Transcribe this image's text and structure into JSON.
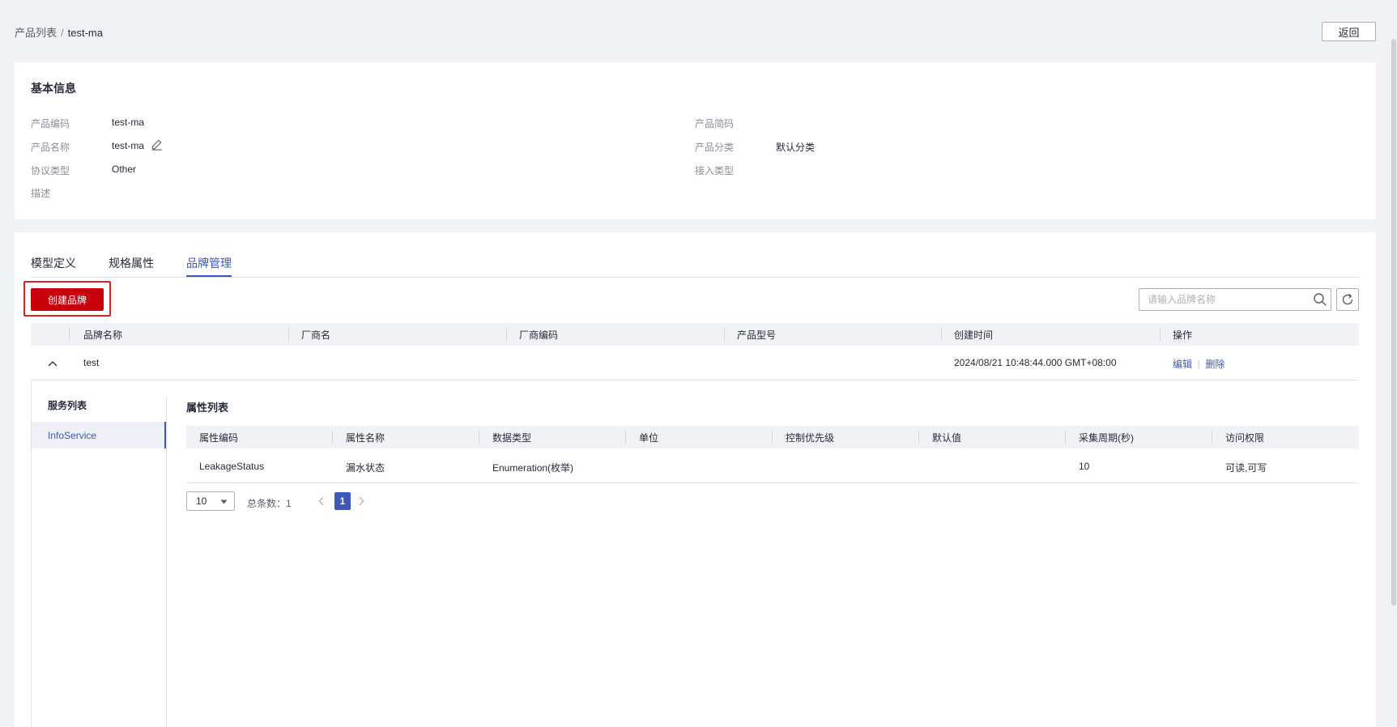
{
  "breadcrumb": {
    "parent": "产品列表",
    "separator": "/",
    "current": "test-ma"
  },
  "header": {
    "back_label": "返回"
  },
  "basic_info": {
    "title": "基本信息",
    "fields": {
      "product_code_label": "产品编码",
      "product_code_value": "test-ma",
      "product_name_label": "产品名称",
      "product_name_value": "test-ma",
      "protocol_label": "协议类型",
      "protocol_value": "Other",
      "description_label": "描述",
      "short_code_label": "产品简码",
      "category_label": "产品分类",
      "category_value": "默认分类",
      "access_type_label": "接入类型"
    }
  },
  "tabs": [
    {
      "label": "模型定义"
    },
    {
      "label": "规格属性"
    },
    {
      "label": "品牌管理",
      "active": true
    }
  ],
  "toolbar": {
    "create_label": "创建品牌",
    "search_placeholder": "请输入品牌名称"
  },
  "brand_table": {
    "columns": [
      "品牌名称",
      "厂商名",
      "厂商编码",
      "产品型号",
      "创建时间",
      "操作"
    ],
    "rows": [
      {
        "brand_name": "test",
        "vendor_name": "",
        "vendor_code": "",
        "product_model": "",
        "created_at": "2024/08/21 10:48:44.000 GMT+08:00",
        "actions": {
          "edit": "编辑",
          "separator": "|",
          "delete": "删除"
        }
      }
    ]
  },
  "service_panel": {
    "title": "服务列表",
    "services": [
      "InfoService"
    ]
  },
  "property_panel": {
    "title": "属性列表",
    "columns": [
      "属性编码",
      "属性名称",
      "数据类型",
      "单位",
      "控制优先级",
      "默认值",
      "采集周期(秒)",
      "访问权限"
    ],
    "rows": [
      [
        "LeakageStatus",
        "漏水状态",
        "Enumeration(枚举)",
        "",
        "",
        "",
        "10",
        "可读,可写"
      ]
    ]
  },
  "pagination": {
    "page_size": "10",
    "total_label": "总条数：1",
    "current_page": "1"
  },
  "colors": {
    "accent": "#3d58b8",
    "primary_button": "#c7000b",
    "highlight_border": "#e02020"
  }
}
